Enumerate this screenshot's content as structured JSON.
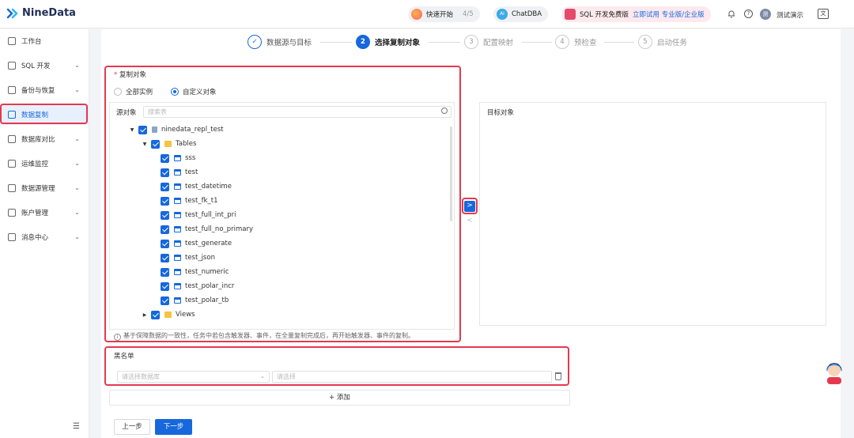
{
  "app": {
    "brand": "NineData",
    "brand_color": "#1668dc"
  },
  "header": {
    "quick_start": {
      "label": "快速开始",
      "progress": "4/5"
    },
    "chatdba": {
      "label": "ChatDBA"
    },
    "sql_promo": {
      "label": "SQL 开发免费版",
      "link": "立即试用 专业版/企业版"
    },
    "user": {
      "name": "测试演示",
      "avatar_letter": "测"
    },
    "lang_label": "文"
  },
  "sidebar": {
    "items": [
      {
        "label": "工作台",
        "icon": "home-icon"
      },
      {
        "label": "SQL 开发",
        "icon": "terminal-icon"
      },
      {
        "label": "备份与恢复",
        "icon": "backup-icon"
      },
      {
        "label": "数据复制",
        "icon": "replication-icon",
        "active": true
      },
      {
        "label": "数据库对比",
        "icon": "compare-icon"
      },
      {
        "label": "运维监控",
        "icon": "monitor-icon"
      },
      {
        "label": "数据源管理",
        "icon": "datasource-icon"
      },
      {
        "label": "账户管理",
        "icon": "account-icon"
      },
      {
        "label": "消息中心",
        "icon": "message-icon"
      }
    ]
  },
  "steps": [
    {
      "num": "✓",
      "label": "数据源与目标",
      "state": "done"
    },
    {
      "num": "2",
      "label": "选择复制对象",
      "state": "current"
    },
    {
      "num": "3",
      "label": "配置映射",
      "state": "todo"
    },
    {
      "num": "4",
      "label": "预检查",
      "state": "todo"
    },
    {
      "num": "5",
      "label": "启动任务",
      "state": "todo"
    }
  ],
  "form": {
    "required_mark": "*",
    "copy_object_label": "复制对象",
    "radio_all": "全部实例",
    "radio_custom": "自定义对象",
    "source_label": "源对象",
    "search_placeholder": "搜索表",
    "target_label": "目标对象",
    "tree": {
      "database": "ninedata_repl_test",
      "tables_folder": "Tables",
      "tables": [
        "sss",
        "test",
        "test_datetime",
        "test_fk_t1",
        "test_full_int_pri",
        "test_full_no_primary",
        "test_generate",
        "test_json",
        "test_numeric",
        "test_polar_incr",
        "test_polar_tb"
      ],
      "views_folder": "Views"
    },
    "note": "基于保障数据的一致性，任务中若包含触发器、事件，在全量复制完成后，再开始触发器、事件的复制。",
    "move_right": ">",
    "move_left": "<",
    "blacklist_label": "黑名单",
    "blacklist_db_placeholder": "请选择数据库",
    "blacklist_obj_placeholder": "请选择",
    "add_label": "+ 添加",
    "prev_label": "上一步",
    "next_label": "下一步"
  }
}
